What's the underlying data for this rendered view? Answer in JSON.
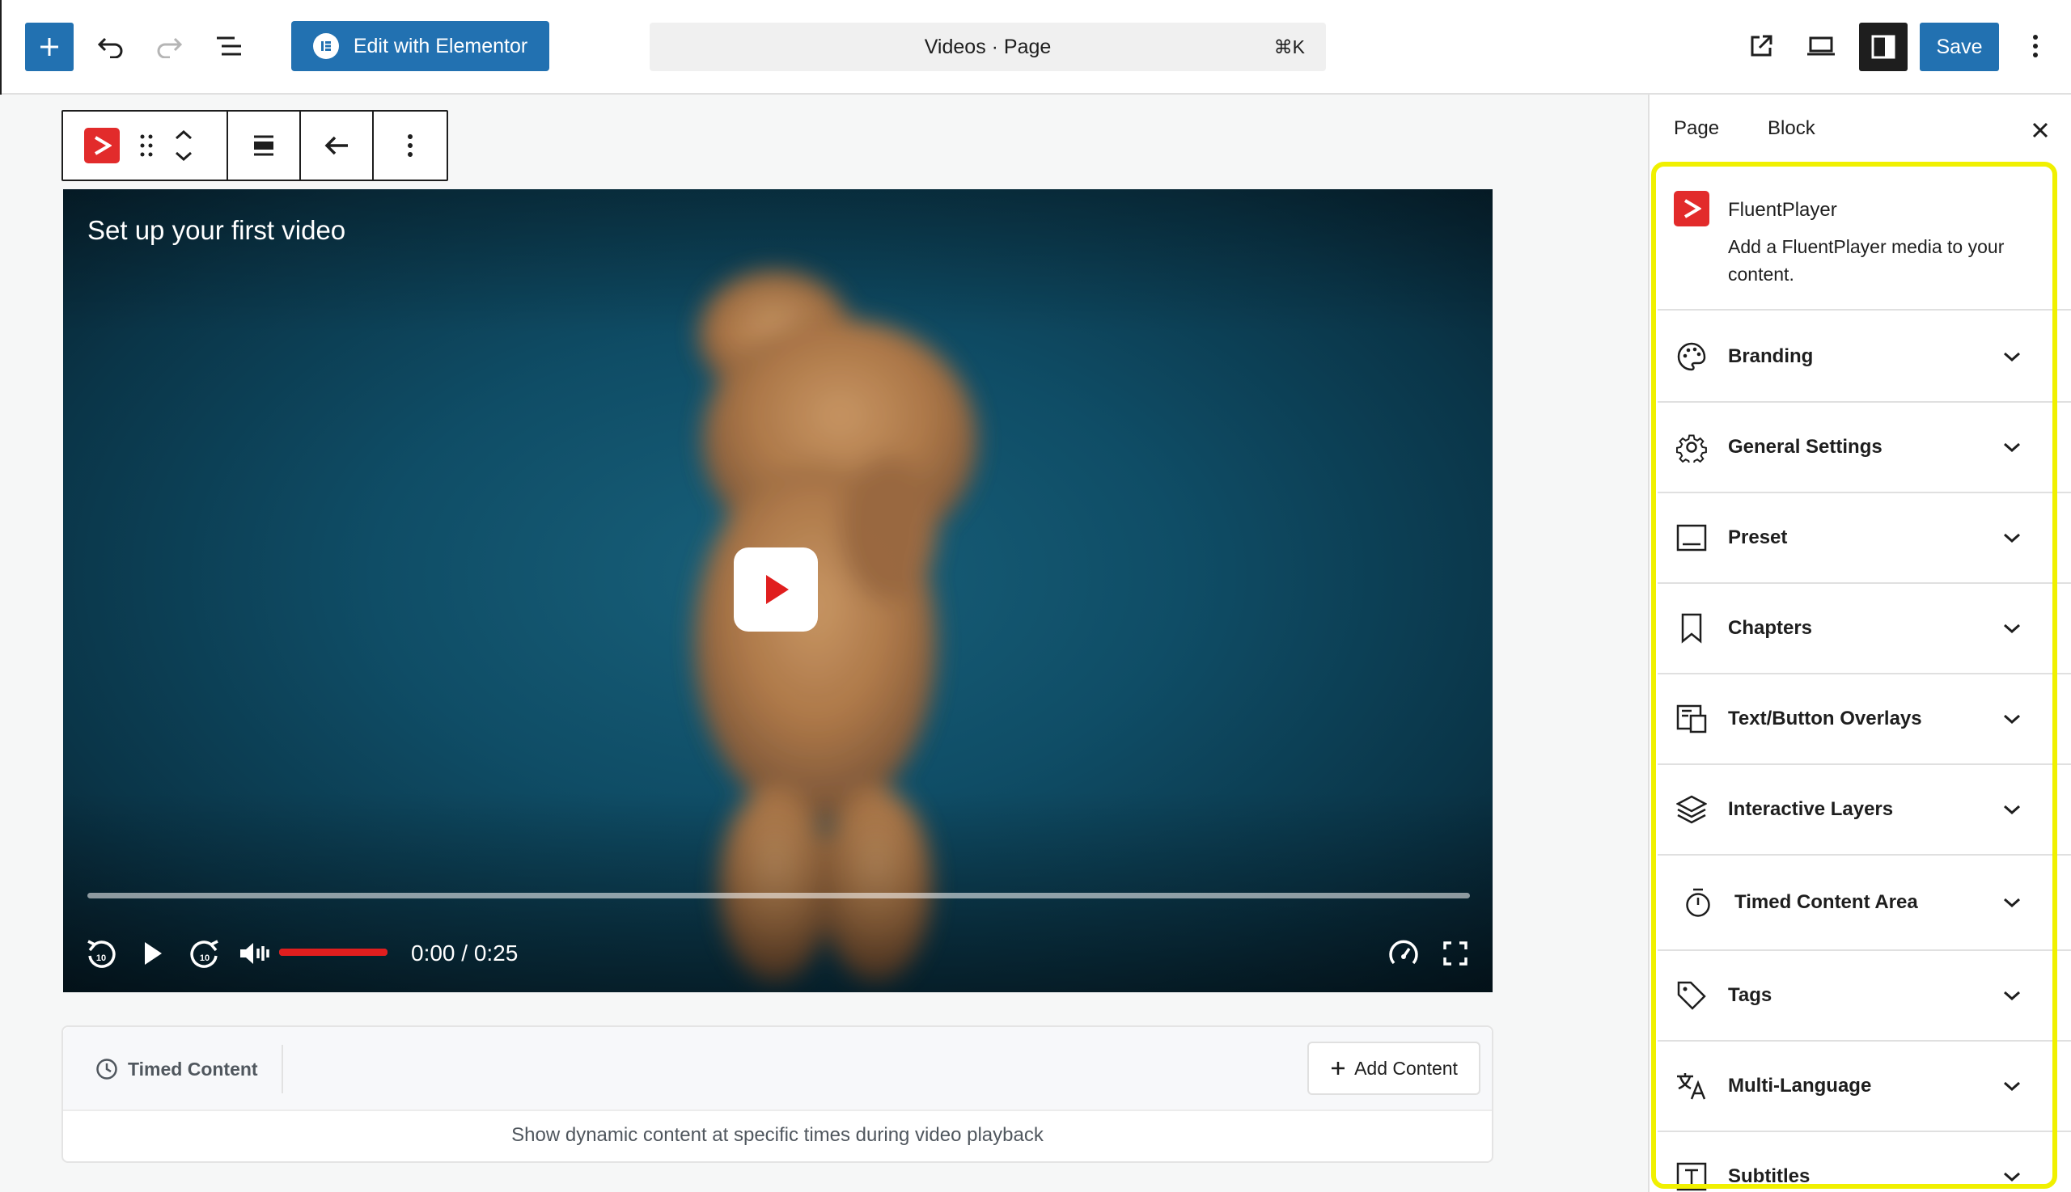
{
  "header": {
    "elementor_label": "Edit with Elementor",
    "document_title": "Videos · Page",
    "shortcut": "⌘K",
    "save_label": "Save",
    "icons": [
      "plus-icon",
      "undo-icon",
      "redo-icon",
      "document-overview-icon",
      "external-link-icon",
      "desktop-preview-icon",
      "sidebar-icon",
      "more-vertical-icon"
    ]
  },
  "colors": {
    "accent": "#2271b1",
    "fluentplayer_red": "#e22b2b",
    "highlight": "#f0f000",
    "volume_red": "#e01e1e"
  },
  "video": {
    "title": "Set up your first video",
    "time": "0:00 / 0:25",
    "progress": 0,
    "volume": 1.0
  },
  "timed": {
    "tab_label": "Timed Content",
    "add_label": "Add Content",
    "description": "Show dynamic content at specific times during video playback"
  },
  "sidebar": {
    "tabs": [
      "Page",
      "Block"
    ],
    "block": {
      "name": "FluentPlayer",
      "description": "Add a FluentPlayer media to your content."
    },
    "panels": [
      {
        "label": "Branding",
        "icon": "palette-icon"
      },
      {
        "label": "General Settings",
        "icon": "gear-icon"
      },
      {
        "label": "Preset",
        "icon": "preset-icon"
      },
      {
        "label": "Chapters",
        "icon": "bookmark-icon"
      },
      {
        "label": "Text/Button Overlays",
        "icon": "overlay-icon"
      },
      {
        "label": "Interactive Layers",
        "icon": "layers-icon"
      },
      {
        "label": "Timed Content Area",
        "icon": "stopwatch-icon"
      },
      {
        "label": "Tags",
        "icon": "tag-icon"
      },
      {
        "label": "Multi-Language",
        "icon": "translate-icon"
      },
      {
        "label": "Subtitles",
        "icon": "subtitles-icon"
      }
    ]
  }
}
